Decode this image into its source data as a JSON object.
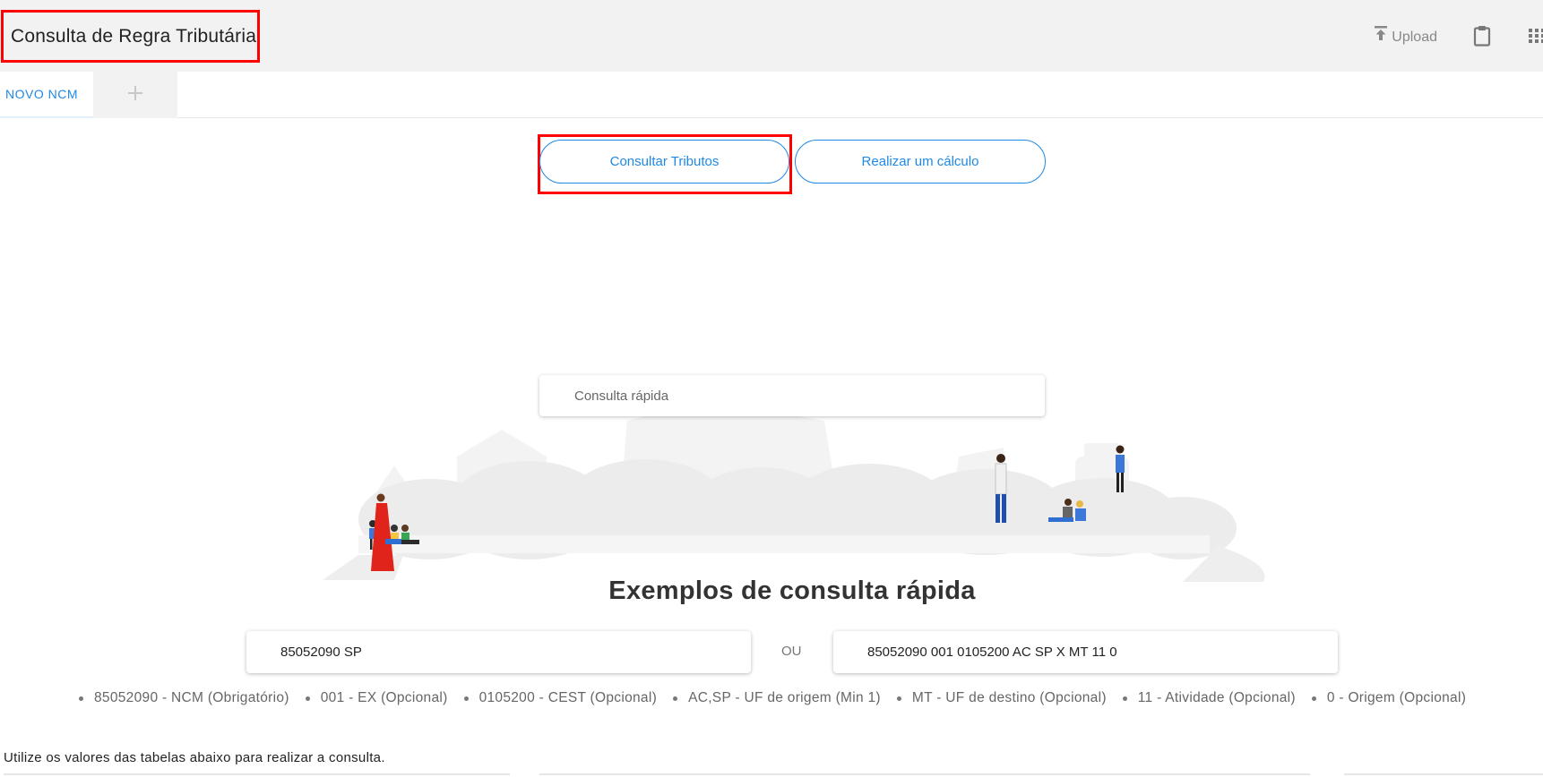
{
  "header": {
    "title": "Consulta de Regra Tributária",
    "upload_label": "Upload",
    "icons": [
      "upload-icon",
      "clipboard-icon",
      "apps-grid-icon"
    ]
  },
  "tabs": {
    "active_label": "NOVO NCM",
    "add_icon": "plus-icon"
  },
  "modes": {
    "consult_label": "Consultar Tributos",
    "calc_label": "Realizar um cálculo"
  },
  "search": {
    "placeholder": "Consulta rápida"
  },
  "examples": {
    "title": "Exemplos de consulta rápida",
    "example_simple": "85052090 SP",
    "separator": "OU",
    "example_full": "85052090 001 0105200 AC SP X MT 11 0",
    "legend": [
      "85052090 - NCM (Obrigatório)",
      "001 - EX (Opcional)",
      "0105200 - CEST (Opcional)",
      "AC,SP - UF de origem (Min 1)",
      "MT - UF de destino (Opcional)",
      "11 - Atividade (Opcional)",
      "0 - Origem (Opcional)"
    ]
  },
  "instructions": "Utilize os valores das tabelas abaixo para realizar a consulta.",
  "colors": {
    "accent": "#1e88e5",
    "highlight": "#ff0000",
    "header_bg": "#f2f2f2"
  }
}
